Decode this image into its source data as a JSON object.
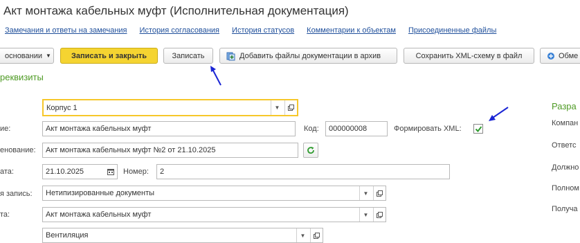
{
  "window": {
    "title": "Акт монтажа кабельных муфт (Исполнительная документация)"
  },
  "nav_links": [
    "Замечания и ответы на замечания",
    "История согласования",
    "История статусов",
    "Комментарии к объектам",
    "Присоединенные файлы"
  ],
  "toolbar": {
    "create_based_on": "основании",
    "save_and_close": "Записать и закрыть",
    "save": "Записать",
    "add_files": "Добавить файлы документации в архив",
    "save_xml": "Сохранить XML-схему в файл",
    "exchange": "Обме"
  },
  "section_title": "реквизиты",
  "form": {
    "building": {
      "value": "Корпус 1"
    },
    "name": {
      "label": "ие:",
      "value": "Акт монтажа кабельных муфт"
    },
    "code": {
      "label": "Код:",
      "value": "000000008"
    },
    "generate_xml": {
      "label": "Формировать XML:",
      "checked": true
    },
    "full_name": {
      "label": "енование:",
      "value": "Акт монтажа кабельных муфт №2 от 21.10.2025"
    },
    "date": {
      "label": "ата:",
      "value": "21.10.2025"
    },
    "number": {
      "label": "Номер:",
      "value": "2"
    },
    "register_entry": {
      "label": "я запись:",
      "value": "Нетипизированные документы"
    },
    "type": {
      "label": "та:",
      "value": "Акт монтажа кабельных муфт"
    },
    "system": {
      "value": "Вентиляция"
    }
  },
  "right_panel": {
    "title": "Разра",
    "labels": [
      "Компан",
      "Ответс",
      "Должно",
      "Полном",
      "Получа"
    ]
  },
  "colors": {
    "primary_button": "#f5d431",
    "section_green": "#4e9a24",
    "link_blue": "#1f4f9b",
    "annotation_arrow": "#1a25d4"
  },
  "icons": [
    "triangle-down-icon",
    "add-files-icon",
    "exchange-icon",
    "open-icon",
    "refresh-icon",
    "calendar-icon",
    "checkmark-icon",
    "arrow-annotation-icon"
  ]
}
